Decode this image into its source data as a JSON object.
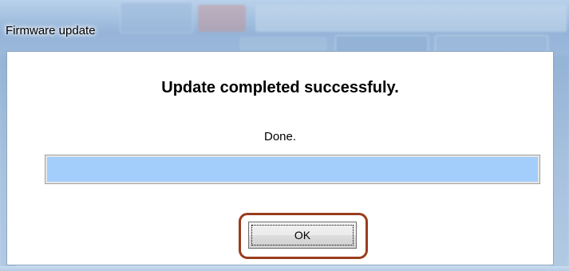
{
  "window": {
    "title": "Firmware update"
  },
  "dialog": {
    "heading": "Update completed successfuly.",
    "status_text": "Done.",
    "progress_fraction": 1.0,
    "ok_label": "OK"
  },
  "colors": {
    "progress_fill": "#a3cdfa",
    "highlight_border": "#9a3c1d"
  }
}
